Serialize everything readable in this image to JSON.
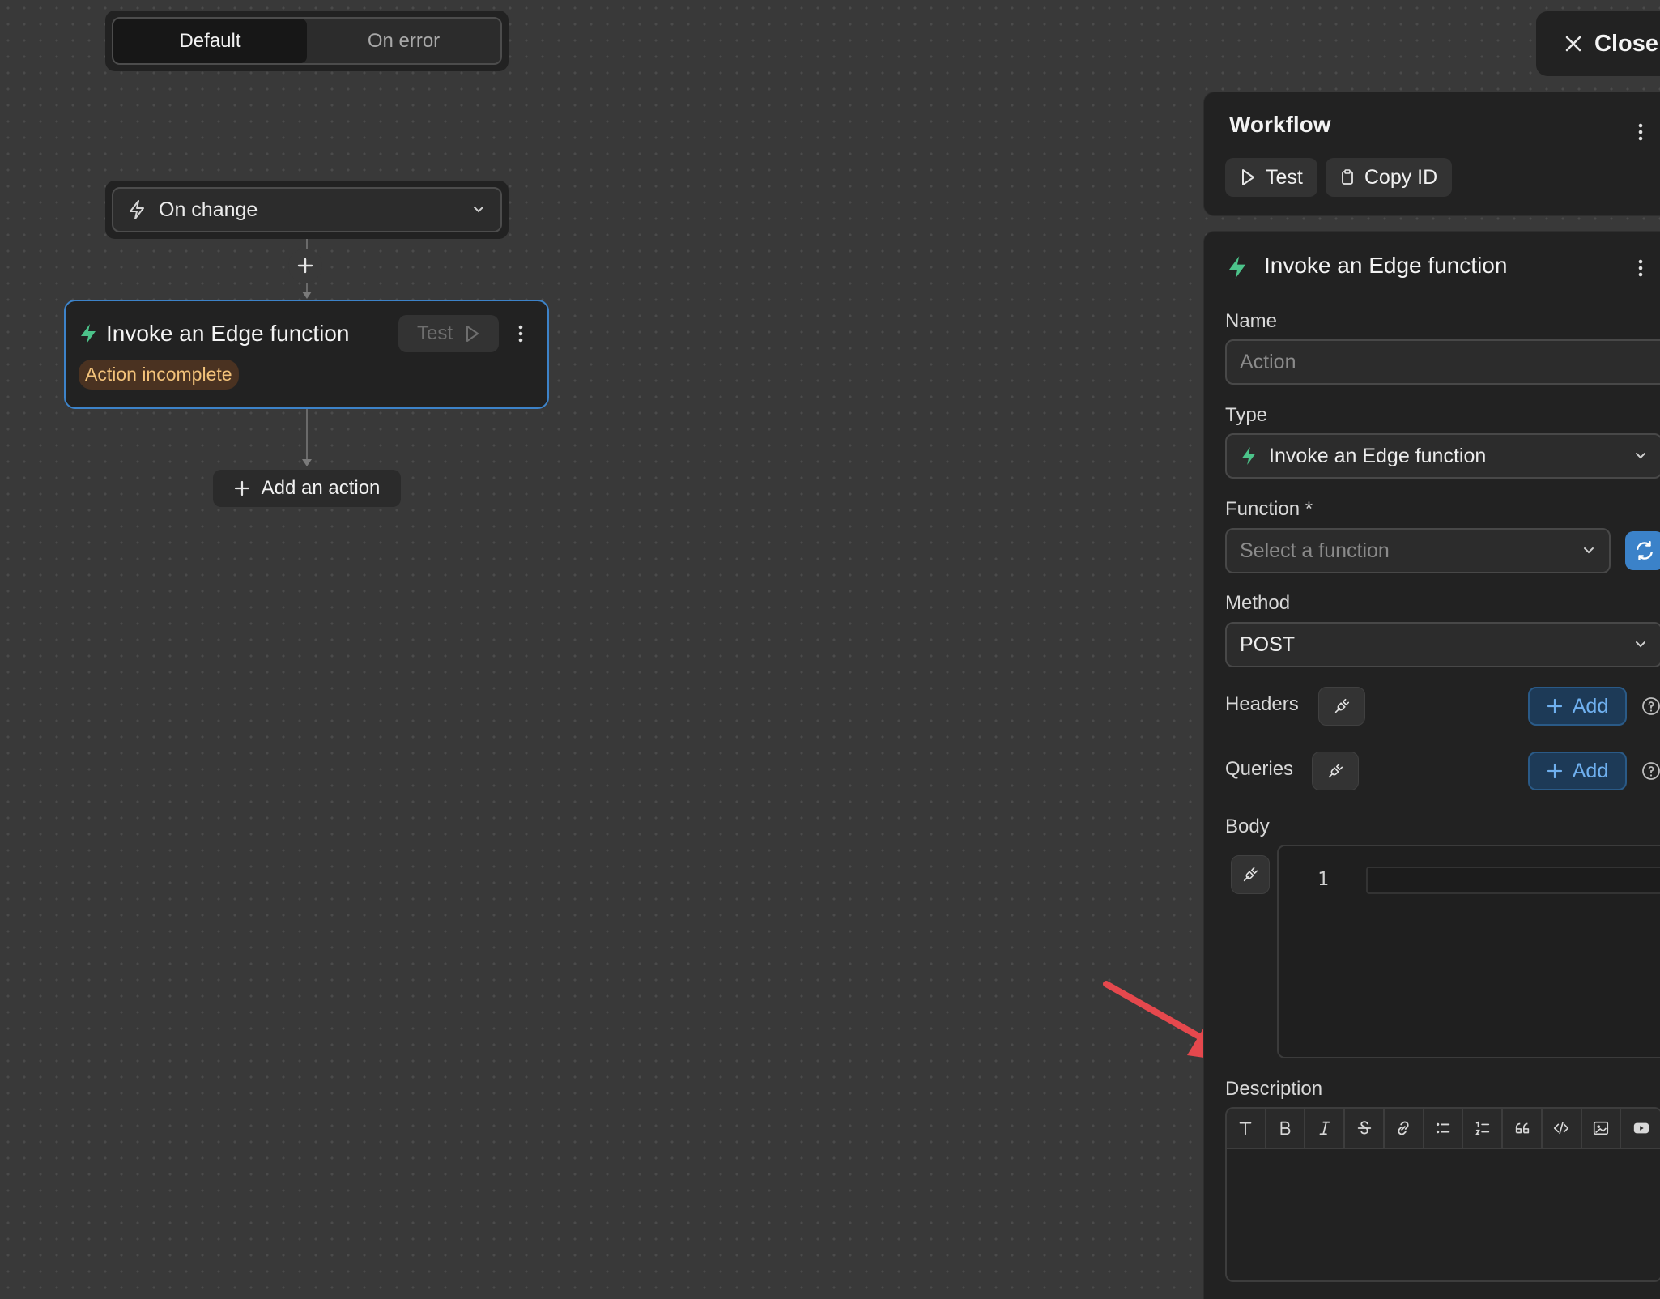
{
  "canvas": {
    "toggle": {
      "default_label": "Default",
      "error_label": "On error",
      "active": "Default"
    },
    "trigger": {
      "label": "On change"
    },
    "action_card": {
      "title": "Invoke an Edge function",
      "test_label": "Test",
      "status_badge": "Action incomplete"
    },
    "add_action_label": "Add an action"
  },
  "close_label": "Close",
  "workflow_panel": {
    "title": "Workflow",
    "test_label": "Test",
    "copy_id_label": "Copy ID"
  },
  "action_panel": {
    "title": "Invoke an Edge function",
    "name": {
      "label": "Name",
      "placeholder": "Action"
    },
    "type": {
      "label": "Type",
      "value": "Invoke an Edge function"
    },
    "function": {
      "label": "Function",
      "required_mark": "*",
      "placeholder": "Select a function"
    },
    "method": {
      "label": "Method",
      "value": "POST"
    },
    "headers": {
      "label": "Headers",
      "add_label": "Add"
    },
    "queries": {
      "label": "Queries",
      "add_label": "Add"
    },
    "body": {
      "label": "Body",
      "line_number": "1"
    },
    "description": {
      "label": "Description"
    }
  },
  "colors": {
    "accent_blue": "#3b82c9",
    "edge_function_green": "#4cc38a",
    "warning_badge_text": "#f2c27a",
    "annotation_red": "#e5484d"
  }
}
